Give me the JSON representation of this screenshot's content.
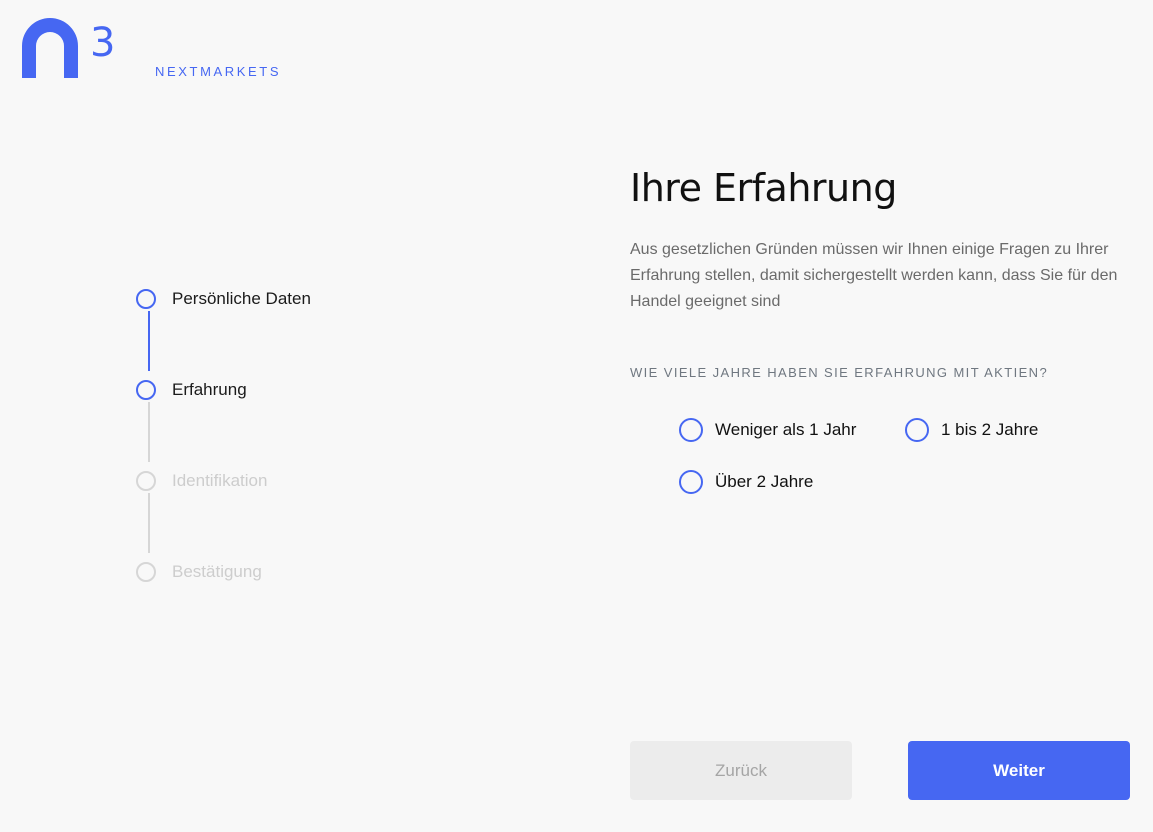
{
  "brand": {
    "name": "NEXTMARKETS",
    "superscript": "3",
    "logo_icon": "n3-logo-icon",
    "color": "#4667f2"
  },
  "colors": {
    "accent": "#4667f2",
    "inactive": "#d6d6d6",
    "inactive_text": "#cdcdcd",
    "body_text": "#6a6a6a",
    "question_text": "#6f7780",
    "back_button_bg": "#ececec",
    "back_button_text": "#a5a5a5",
    "next_button_bg": "#4667f2"
  },
  "stepper": {
    "steps": [
      {
        "label": "Persönliche Daten",
        "status": "active"
      },
      {
        "label": "Erfahrung",
        "status": "active"
      },
      {
        "label": "Identifikation",
        "status": "inactive"
      },
      {
        "label": "Bestätigung",
        "status": "inactive"
      }
    ],
    "connectors": [
      "active",
      "inactive",
      "inactive"
    ]
  },
  "main": {
    "title": "Ihre Erfahrung",
    "description": "Aus gesetzlichen Gründen müssen wir Ihnen einige Fragen zu Ihrer Erfahrung stellen, damit sichergestellt werden kann, dass Sie für den Handel geeignet sind",
    "question": "Wie viele Jahre haben Sie Erfahrung mit Aktien?",
    "options": [
      {
        "label": "Weniger als 1 Jahr",
        "selected": false
      },
      {
        "label": "1 bis 2 Jahre",
        "selected": false
      },
      {
        "label": "Über 2 Jahre",
        "selected": false
      }
    ]
  },
  "buttons": {
    "back_label": "Zurück",
    "next_label": "Weiter"
  }
}
